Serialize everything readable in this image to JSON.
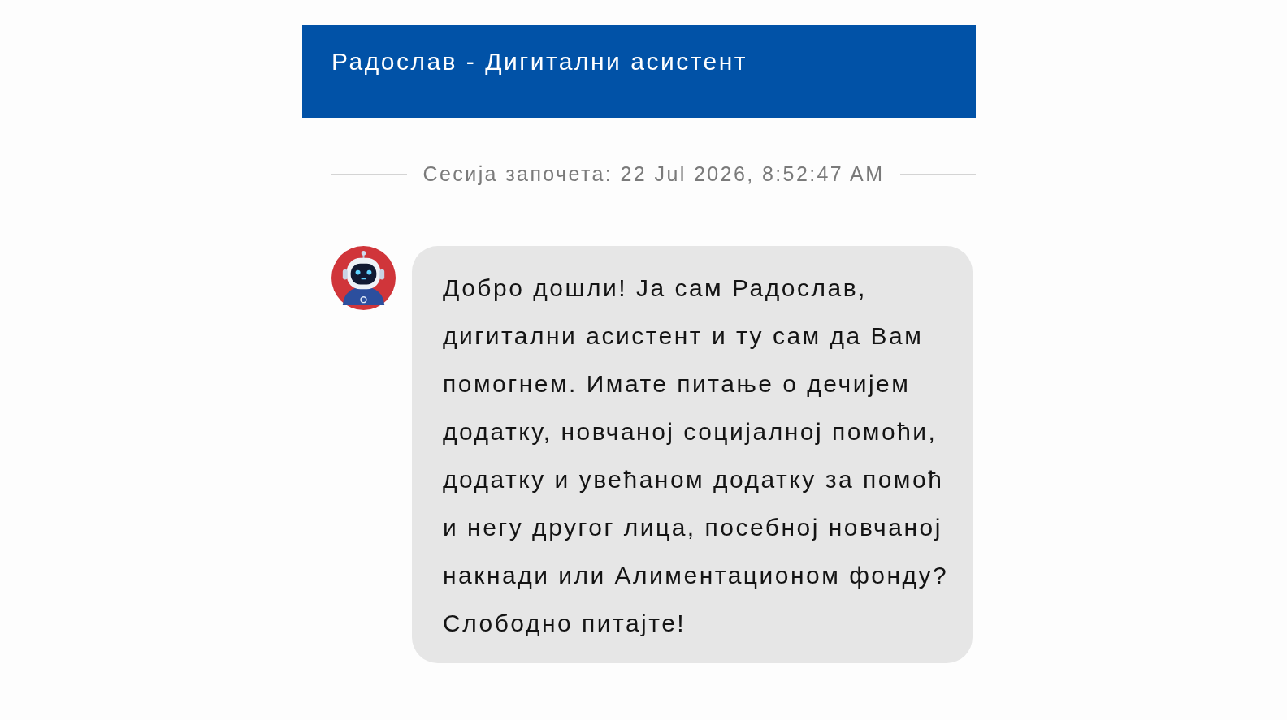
{
  "header": {
    "title": "Радослав - Дигитални асистент"
  },
  "session": {
    "label": "Сесија започета: 22 Jul 2026, 8:52:47 AM"
  },
  "messages": [
    {
      "kind": "bot",
      "text": "Добро дошли! Ја сам Радослав, дигитални асистент и ту сам да Вам помогнем. Имате питање о дечијем додатку, новчаној социјалној помоћи, додатку и увећаном додатку за помоћ и негу другог лица, посебној новчаној накнади или Алиментационом фонду? Слободно питајте!"
    }
  ]
}
